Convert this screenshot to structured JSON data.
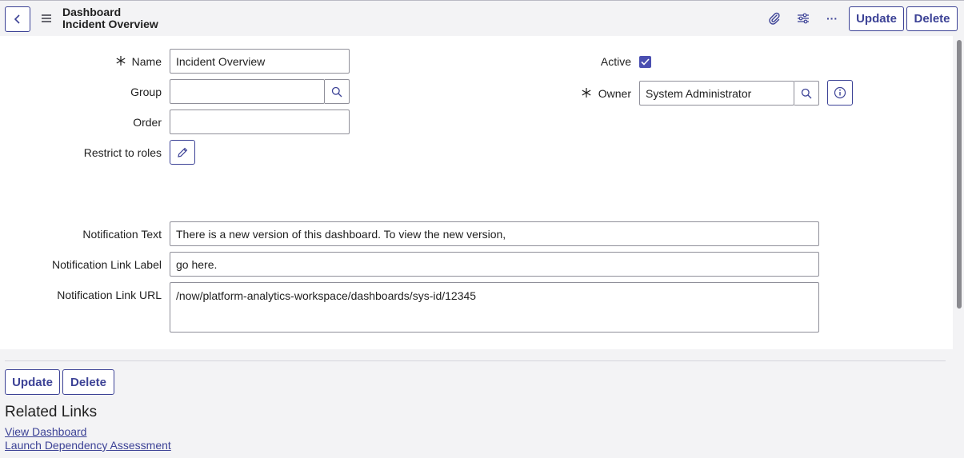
{
  "header": {
    "title_line1": "Dashboard",
    "title_line2": "Incident Overview",
    "update_label": "Update",
    "delete_label": "Delete",
    "more_label": "···"
  },
  "form": {
    "name": {
      "label": "Name",
      "value": "Incident Overview"
    },
    "group": {
      "label": "Group",
      "value": ""
    },
    "order": {
      "label": "Order",
      "value": ""
    },
    "restrict_roles": {
      "label": "Restrict to roles"
    },
    "active": {
      "label": "Active",
      "checked": true
    },
    "owner": {
      "label": "Owner",
      "value": "System Administrator"
    },
    "notification_text": {
      "label": "Notification Text",
      "value": "There is a new version of this dashboard. To view the new version,"
    },
    "notification_link_label": {
      "label": "Notification Link Label",
      "value": "go here."
    },
    "notification_link_url": {
      "label": "Notification Link URL",
      "value": "/now/platform-analytics-workspace/dashboards/sys-id/12345"
    }
  },
  "footer": {
    "update_label": "Update",
    "delete_label": "Delete"
  },
  "related_links": {
    "title": "Related Links",
    "items": [
      "View Dashboard",
      "Launch Dependency Assessment"
    ]
  },
  "colors": {
    "accent": "#3c4296",
    "checkbox": "#4a4fb1",
    "background": "#f3f3f5"
  }
}
